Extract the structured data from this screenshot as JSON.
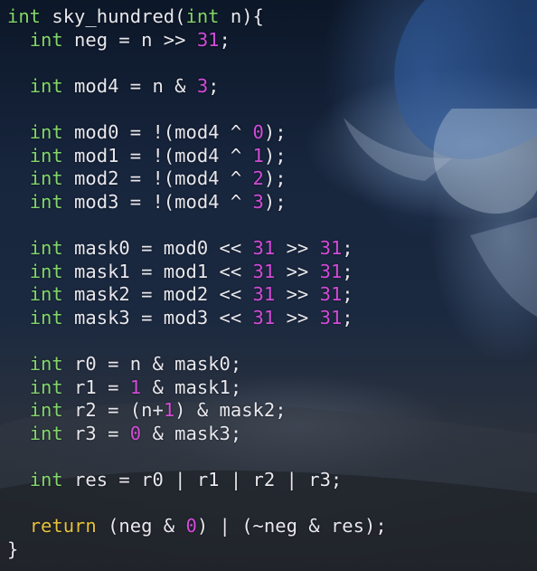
{
  "editor": {
    "lines": [
      [
        [
          "kw",
          "int"
        ],
        [
          "txt",
          " sky_hundred("
        ],
        [
          "kw",
          "int"
        ],
        [
          "txt",
          " n){"
        ]
      ],
      [
        [
          "txt",
          "  "
        ],
        [
          "kw",
          "int"
        ],
        [
          "txt",
          " neg = n >> "
        ],
        [
          "num",
          "31"
        ],
        [
          "txt",
          ";"
        ]
      ],
      [],
      [
        [
          "txt",
          "  "
        ],
        [
          "kw",
          "int"
        ],
        [
          "txt",
          " mod4 = n & "
        ],
        [
          "num",
          "3"
        ],
        [
          "txt",
          ";"
        ]
      ],
      [],
      [
        [
          "txt",
          "  "
        ],
        [
          "kw",
          "int"
        ],
        [
          "txt",
          " mod0 = !(mod4 ^ "
        ],
        [
          "num",
          "0"
        ],
        [
          "txt",
          ");"
        ]
      ],
      [
        [
          "txt",
          "  "
        ],
        [
          "kw",
          "int"
        ],
        [
          "txt",
          " mod1 = !(mod4 ^ "
        ],
        [
          "num",
          "1"
        ],
        [
          "txt",
          ");"
        ]
      ],
      [
        [
          "txt",
          "  "
        ],
        [
          "kw",
          "int"
        ],
        [
          "txt",
          " mod2 = !(mod4 ^ "
        ],
        [
          "num",
          "2"
        ],
        [
          "txt",
          ");"
        ]
      ],
      [
        [
          "txt",
          "  "
        ],
        [
          "kw",
          "int"
        ],
        [
          "txt",
          " mod3 = !(mod4 ^ "
        ],
        [
          "num",
          "3"
        ],
        [
          "txt",
          ");"
        ]
      ],
      [],
      [
        [
          "txt",
          "  "
        ],
        [
          "kw",
          "int"
        ],
        [
          "txt",
          " mask0 = mod0 << "
        ],
        [
          "num",
          "31"
        ],
        [
          "txt",
          " >> "
        ],
        [
          "num",
          "31"
        ],
        [
          "txt",
          ";"
        ]
      ],
      [
        [
          "txt",
          "  "
        ],
        [
          "kw",
          "int"
        ],
        [
          "txt",
          " mask1 = mod1 << "
        ],
        [
          "num",
          "31"
        ],
        [
          "txt",
          " >> "
        ],
        [
          "num",
          "31"
        ],
        [
          "txt",
          ";"
        ]
      ],
      [
        [
          "txt",
          "  "
        ],
        [
          "kw",
          "int"
        ],
        [
          "txt",
          " mask2 = mod2 << "
        ],
        [
          "num",
          "31"
        ],
        [
          "txt",
          " >> "
        ],
        [
          "num",
          "31"
        ],
        [
          "txt",
          ";"
        ]
      ],
      [
        [
          "txt",
          "  "
        ],
        [
          "kw",
          "int"
        ],
        [
          "txt",
          " mask3 = mod3 << "
        ],
        [
          "num",
          "31"
        ],
        [
          "txt",
          " >> "
        ],
        [
          "num",
          "31"
        ],
        [
          "txt",
          ";"
        ]
      ],
      [],
      [
        [
          "txt",
          "  "
        ],
        [
          "kw",
          "int"
        ],
        [
          "txt",
          " r0 = n & mask0;"
        ]
      ],
      [
        [
          "txt",
          "  "
        ],
        [
          "kw",
          "int"
        ],
        [
          "txt",
          " r1 = "
        ],
        [
          "num",
          "1"
        ],
        [
          "txt",
          " & mask1;"
        ]
      ],
      [
        [
          "txt",
          "  "
        ],
        [
          "kw",
          "int"
        ],
        [
          "txt",
          " r2 = (n+"
        ],
        [
          "num",
          "1"
        ],
        [
          "txt",
          ") & mask2;"
        ]
      ],
      [
        [
          "txt",
          "  "
        ],
        [
          "kw",
          "int"
        ],
        [
          "txt",
          " r3 = "
        ],
        [
          "num",
          "0"
        ],
        [
          "txt",
          " & mask3;"
        ]
      ],
      [],
      [
        [
          "txt",
          "  "
        ],
        [
          "kw",
          "int"
        ],
        [
          "txt",
          " res = r0 | r1 | r2 | r3;"
        ]
      ],
      [],
      [
        [
          "txt",
          "  "
        ],
        [
          "ret",
          "return"
        ],
        [
          "txt",
          " (neg & "
        ],
        [
          "num",
          "0"
        ],
        [
          "txt",
          ") | (~neg & res);"
        ]
      ],
      [
        [
          "txt",
          "}"
        ]
      ]
    ]
  },
  "colors": {
    "keyword": "#82d66a",
    "number": "#d24bd9",
    "return_keyword": "#e6c23a",
    "text": "#e8e8ee"
  }
}
